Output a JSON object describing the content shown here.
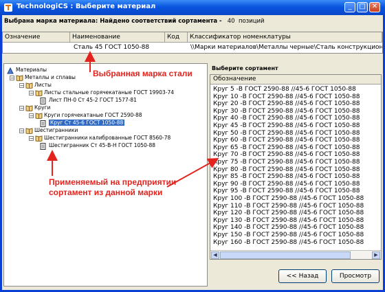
{
  "window": {
    "title": "TechnologiCS : Выберите материал"
  },
  "status": {
    "label": "Выбрана марка материала: Найдено соответствий сортамента -",
    "count": "40",
    "unit": "позиций"
  },
  "grid": {
    "headers": [
      "Означение",
      "Наименование",
      "Код",
      "Классификатор номенклатуры"
    ],
    "row": {
      "name": "Сталь 45 ГОСТ 1050-88",
      "classifier": "\\\\Марки материалов\\Металлы черные\\Сталь конструкционная\\Ка"
    }
  },
  "tree": [
    {
      "label": "Материалы",
      "icon": "materials-icon"
    },
    {
      "label": "Металлы и сплавы",
      "icon": "book-icon"
    },
    {
      "label": "Листы",
      "icon": "book-icon"
    },
    {
      "label": "Листы стальные горячекатаные ГОСТ 19903-74",
      "icon": "book-icon"
    },
    {
      "label": "Лист ПН-0 Ст 45-2 ГОСТ 1577-81",
      "icon": "doc-icon"
    },
    {
      "label": "Круги",
      "icon": "book-icon"
    },
    {
      "label": "Круги горячекатаные ГОСТ 2590-88",
      "icon": "book-icon"
    },
    {
      "label": "Круг Ст 45-6 ГОСТ 1050-88",
      "icon": "doc-icon"
    },
    {
      "label": "Шестигранники",
      "icon": "book-icon"
    },
    {
      "label": "Шестигранники калиброванные ГОСТ 8560-78",
      "icon": "book-icon"
    },
    {
      "label": "Шестигранник Ст 45-В-Н ГОСТ 1050-88",
      "icon": "doc-icon"
    }
  ],
  "right": {
    "title": "Выберите сортамент",
    "column": "Обозначение",
    "rows": [
      "Круг   5   -В ГОСТ 2590-88 //45-6 ГОСТ 1050-88",
      "Круг   10  -В ГОСТ 2590-88 //45-6 ГОСТ 1050-88",
      "Круг   20  -В ГОСТ 2590-88 //45-6 ГОСТ 1050-88",
      "Круг   30  -В ГОСТ 2590-88 //45-6 ГОСТ 1050-88",
      "Круг   40  -В ГОСТ 2590-88 //45-6 ГОСТ 1050-88",
      "Круг   45  -В ГОСТ 2590-88 //45-6 ГОСТ 1050-88",
      "Круг   50  -В ГОСТ 2590-88 //45-6 ГОСТ 1050-88",
      "Круг   60  -В ГОСТ 2590-88 //45-6 ГОСТ 1050-88",
      "Круг   65  -В ГОСТ 2590-88 //45-6 ГОСТ 1050-88",
      "Круг   70  -В ГОСТ 2590-88 //45-6 ГОСТ 1050-88",
      "Круг   75  -В ГОСТ 2590-88 //45-6 ГОСТ 1050-88",
      "Круг   80  -В ГОСТ 2590-88 //45-6 ГОСТ 1050-88",
      "Круг   85  -В ГОСТ 2590-88 //45-6 ГОСТ 1050-88",
      "Круг   90  -В ГОСТ 2590-88 //45-6 ГОСТ 1050-88",
      "Круг   95  -В ГОСТ 2590-88 //45-6 ГОСТ 1050-88",
      "Круг   100  -В ГОСТ 2590-88 //45-6 ГОСТ 1050-88",
      "Круг   110  -В ГОСТ 2590-88 //45-6 ГОСТ 1050-88",
      "Круг   120  -В ГОСТ 2590-88 //45-6 ГОСТ 1050-88",
      "Круг   130  -В ГОСТ 2590-88 //45-6 ГОСТ 1050-88",
      "Круг   140  -В ГОСТ 2590-88 //45-6 ГОСТ 1050-88",
      "Круг   150  -В ГОСТ 2590-88 //45-6 ГОСТ 1050-88",
      "Круг   160  -В ГОСТ 2590-88 //45-6 ГОСТ 1050-88"
    ],
    "back_label": "<< Назад",
    "view_label": "Просмотр"
  },
  "annotations": {
    "brand": "Выбранная марка стали",
    "assortment": "Применяемый на предприятии сортамент из данной марки"
  },
  "colors": {
    "title_blue": "#0a56e0",
    "annotation_red": "#e3231e",
    "selection": "#316ac5"
  }
}
